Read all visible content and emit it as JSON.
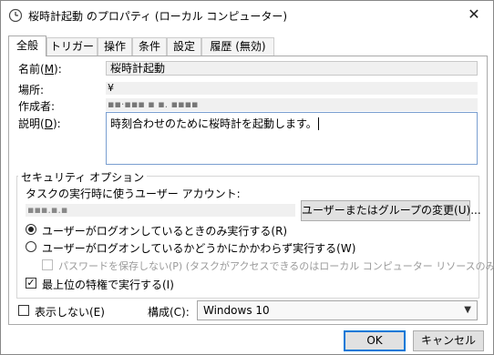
{
  "window": {
    "title": "桜時計起動 のプロパティ (ローカル コンピューター)",
    "icon": "clock-icon",
    "close_glyph": "✕"
  },
  "tabs": [
    {
      "label": "全般"
    },
    {
      "label": "トリガー"
    },
    {
      "label": "操作"
    },
    {
      "label": "条件"
    },
    {
      "label": "設定"
    },
    {
      "label": "履歴 (無効)"
    }
  ],
  "general": {
    "name_label": "名前(",
    "name_key": "M",
    "name_label_end": "):",
    "name_value": "桜時計起動",
    "location_label": "場所:",
    "location_value": "¥",
    "author_label": "作成者:",
    "author_value": "▪▪·▪▪▪ ▪ ▪. ▪▪▪▪",
    "description_label": "説明(",
    "description_key": "D",
    "description_label_end": "):",
    "description_value": "時刻合わせのために桜時計を起動します。"
  },
  "security": {
    "group_title": "セキュリティ オプション",
    "account_prompt": "タスクの実行時に使うユーザー アカウント:",
    "account_value": "▪▪▪.▪.▪",
    "change_button": "ユーザーまたはグループの変更(U)...",
    "radio_logged_on": "ユーザーがログオンしているときのみ実行する(R)",
    "radio_always": "ユーザーがログオンしているかどうかにかかわらず実行する(W)",
    "no_store_password": "パスワードを保存しない(P) (タスクがアクセスできるのはローカル コンピューター リソースのみ)",
    "highest_privileges": "最上位の特権で実行する(I)"
  },
  "footer": {
    "hidden_label": "表示しない(E)",
    "config_label": "構成(C):",
    "config_value": "Windows 10",
    "ok_button": "OK",
    "cancel_button": "キャンセル"
  },
  "colors": {
    "accent": "#0078d7"
  }
}
